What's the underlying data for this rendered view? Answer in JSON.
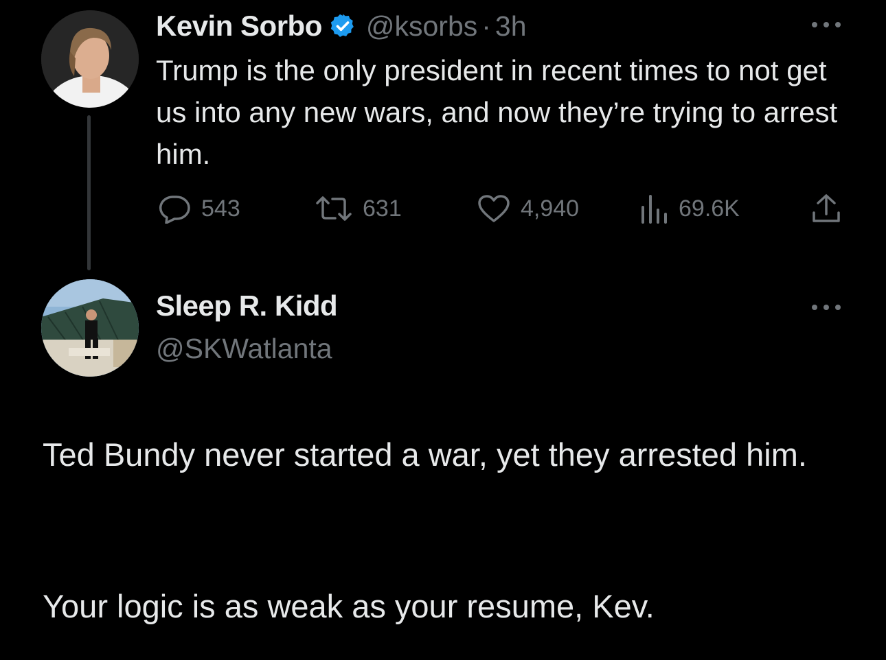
{
  "tweet": {
    "author_name": "Kevin Sorbo",
    "handle": "@ksorbs",
    "separator": "·",
    "time": "3h",
    "text": "Trump is the only president in recent times to not get us into any new wars, and now they’re trying to arrest him.",
    "stats": {
      "replies": "543",
      "retweets": "631",
      "likes": "4,940",
      "views": "69.6K"
    },
    "verified_color": "#1d9bf0"
  },
  "reply": {
    "author_name": "Sleep R. Kidd",
    "handle": "@SKWatlanta",
    "paragraph1": "Ted Bundy never started a war, yet they arrested him.",
    "paragraph2": "Your logic is as weak as your resume, Kev."
  },
  "colors": {
    "background": "#000000",
    "text_primary": "#e7e9ea",
    "text_secondary": "#71767b",
    "thread_line": "#333639"
  },
  "icons": [
    "verified-badge-icon",
    "more-icon",
    "reply-icon",
    "retweet-icon",
    "like-icon",
    "views-icon",
    "share-icon"
  ]
}
